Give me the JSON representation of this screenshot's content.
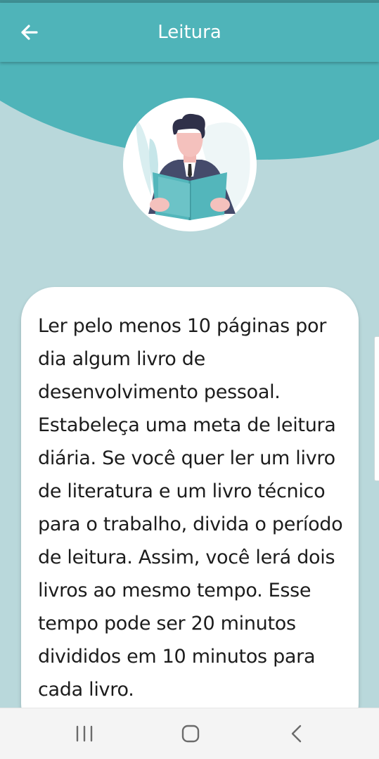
{
  "app_bar": {
    "title": "Leitura",
    "back_icon": "arrow-left-icon",
    "background": "#4fb4b9"
  },
  "illustration": {
    "icon": "person-reading-book-icon"
  },
  "content": {
    "text": "Ler pelo menos 10 páginas por dia algum livro de desenvolvimento pessoal. Estabeleça uma meta de leitura diária. Se você quer ler um livro de literatura e um livro técnico para o trabalho, divida o período de leitura. Assim, você lerá dois livros ao mesmo tempo. Esse tempo pode ser 20 minutos divididos em 10 minutos para cada livro."
  },
  "system_nav": {
    "recent_icon": "recent-apps-icon",
    "home_icon": "home-icon",
    "back_icon": "back-chevron-icon"
  },
  "colors": {
    "accent": "#4fb4b9",
    "page_background": "#b9d8db",
    "card": "#ffffff"
  }
}
